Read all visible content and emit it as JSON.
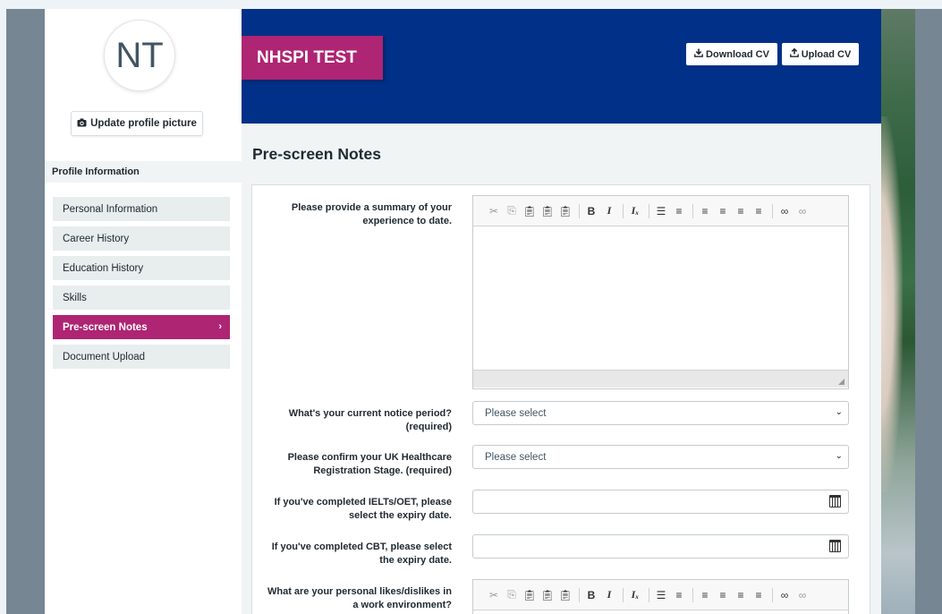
{
  "profile": {
    "initials": "NT",
    "update_picture_label": "Update profile picture",
    "section_header": "Profile Information"
  },
  "sidebar": {
    "items": [
      {
        "label": "Personal Information",
        "active": false
      },
      {
        "label": "Career History",
        "active": false
      },
      {
        "label": "Education History",
        "active": false
      },
      {
        "label": "Skills",
        "active": false
      },
      {
        "label": "Pre-screen Notes",
        "active": true
      },
      {
        "label": "Document Upload",
        "active": false
      }
    ]
  },
  "header": {
    "name": "NHSPI TEST",
    "download_cv_label": "Download CV",
    "upload_cv_label": "Upload CV"
  },
  "main": {
    "section_title": "Pre-screen Notes"
  },
  "form": {
    "summary_label": "Please provide a summary of your experience to date.",
    "summary_value": "",
    "notice_label": "What's your current notice period? (required)",
    "notice_value": "Please select",
    "registration_label": "Please confirm your UK Healthcare Registration Stage. (required)",
    "registration_value": "Please select",
    "ielts_label": "If you've completed IELTs/OET, please select the expiry date.",
    "ielts_value": "",
    "cbt_label": "If you've completed CBT, please select the expiry date.",
    "cbt_value": "",
    "likes_label": "What are your personal likes/dislikes in a work environment?"
  },
  "icons": {
    "camera": "camera-icon",
    "download": "download-icon",
    "upload": "upload-icon",
    "chevron": "chevron-right-icon",
    "calendar": "calendar-icon",
    "dropdown": "chevron-down-icon"
  },
  "colors": {
    "nhs_blue": "#003087",
    "accent_pink": "#ae2573",
    "page_bg": "#f0f4f5"
  }
}
